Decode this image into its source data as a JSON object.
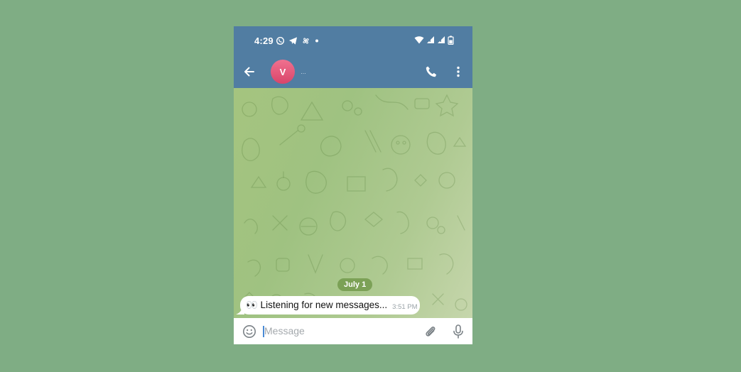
{
  "status_bar": {
    "time": "4:29",
    "left_icons": [
      "whatsapp-icon",
      "telegram-icon",
      "pinwheel-icon",
      "dot-icon"
    ],
    "right_icons": [
      "wifi-icon",
      "signal-icon",
      "signal-icon",
      "battery-icon"
    ]
  },
  "header": {
    "avatar_initial": "V",
    "avatar_color": "#e55a7c",
    "title": "…",
    "bar_color": "#517da2"
  },
  "chat": {
    "date_chip": "July 1",
    "messages": [
      {
        "text": "👀 Listening for new messages...",
        "time": "3:51 PM"
      }
    ]
  },
  "composer": {
    "placeholder": "Message",
    "value": ""
  }
}
